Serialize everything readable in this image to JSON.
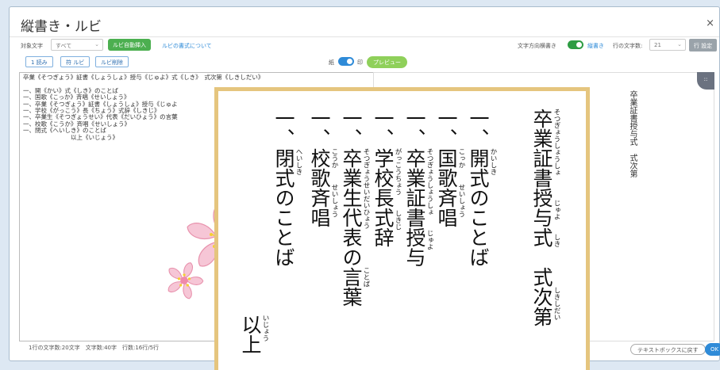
{
  "window": {
    "title": "縦書き・ルビ",
    "close_label": "×"
  },
  "toolbar": {
    "target_label": "対象文字",
    "target_value": "すべて",
    "ruby_button": "ルビ自動挿入",
    "ruby_help_link": "ルビの書式について",
    "direction_label": "文字方向横書き",
    "direction_value": "縦書き",
    "chars_per_line_label": "行の文字数:",
    "chars_per_line_value": "21",
    "right_gray_button": "行 設定",
    "sub_buttons": [
      "1 読み",
      "符 ルビ",
      "ルビ削除"
    ],
    "view_left": "紙",
    "view_right": "印",
    "preview_button": "プレビュー"
  },
  "editor": {
    "lines": [
      "卒業《そつぎょう》証書《しょうしょ》授与《じゅよ》式《しき》　式次第《しきしだい》",
      "",
      "一、開《かい》式《しき》のことば",
      "一、国歌《こっか》斉唱《せいしょう》",
      "一、卒業《そつぎょう》証書《しょうしょ》授与《じゅよ",
      "一、学校《がっこう》長《ちょう》式辞《しきじ》",
      "一、卒業生《そつぎょうせい》代表《だいひょう》の言葉",
      "一、校歌《こうか》斉唱《せいしょう》",
      "一、閉式《へいしき》のことば",
      "　　　　　　　　以上《いじょう》"
    ]
  },
  "right_preview": {
    "cols": [
      "卒業証書授与式　式次第"
    ],
    "grip_label": "::"
  },
  "status": {
    "text": "1行の文字数:20文字　文字数:40字　行数:16行/5行",
    "return_button": "テキストボックスに戻す",
    "ok_button": "OK"
  },
  "card": {
    "columns": [
      {
        "text": "卒業証書授与式　式次第",
        "rubies": [
          {
            "t": "そつぎょうしょうしょ",
            "at": 0
          },
          {
            "t": "じゅよ",
            "at": 4.6
          },
          {
            "t": "しき",
            "at": 6.3
          },
          {
            "t": "しきしだい",
            "at": 9.0
          }
        ]
      },
      {
        "text": "一、開式のことば",
        "rubies": [
          {
            "t": "かいしき",
            "at": 2
          }
        ]
      },
      {
        "text": "一、国歌斉唱",
        "rubies": [
          {
            "t": "こっか",
            "at": 2
          },
          {
            "t": "せいしょう",
            "at": 3.8
          }
        ]
      },
      {
        "text": "一、卒業証書授与",
        "rubies": [
          {
            "t": "そつぎょうしょうしょ",
            "at": 2
          },
          {
            "t": "じゅよ",
            "at": 6.1
          }
        ]
      },
      {
        "text": "一、学校長式辞",
        "rubies": [
          {
            "t": "がっこうちょう",
            "at": 2
          },
          {
            "t": "しきじ",
            "at": 5.1
          }
        ]
      },
      {
        "text": "一、卒業生代表の言葉",
        "rubies": [
          {
            "t": "そつぎょうせいだいひょう",
            "at": 2
          },
          {
            "t": "ことば",
            "at": 8
          }
        ]
      },
      {
        "text": "一、校歌斉唱",
        "rubies": [
          {
            "t": "こうか",
            "at": 2
          },
          {
            "t": "せいしょう",
            "at": 3.8
          }
        ]
      },
      {
        "text": "一、閉式のことば",
        "rubies": [
          {
            "t": "へいしき",
            "at": 2
          }
        ]
      },
      {
        "text": "以上",
        "rubies": [
          {
            "t": "いじょう",
            "at": 0
          }
        ]
      }
    ]
  },
  "colors": {
    "accent": "#4caf50",
    "link": "#2f8bd8",
    "card_border": "#e5c57e",
    "sakura": "#f6c6d6"
  },
  "icons": [
    "sakura-flower-icon",
    "toggle-switch-icon",
    "chevron-down-icon"
  ]
}
